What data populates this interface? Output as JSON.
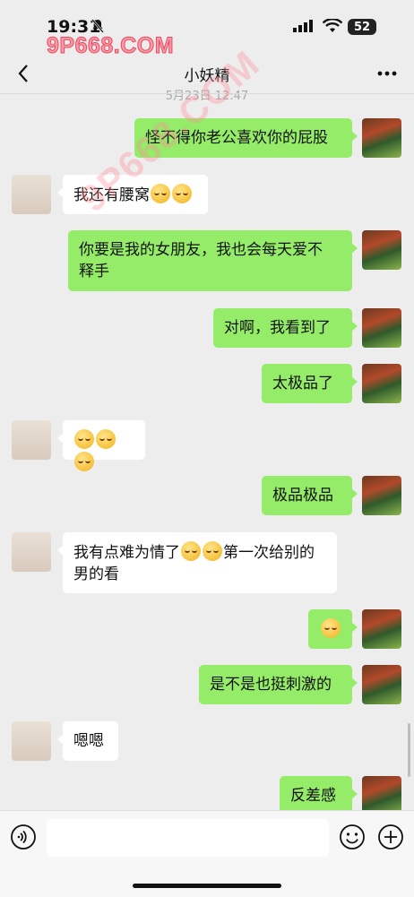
{
  "status_bar": {
    "time": "19:31",
    "battery": "52"
  },
  "watermark": {
    "top": "9P668.COM"
  },
  "header": {
    "title": "小妖精",
    "timestamp": "5月23日 12:47"
  },
  "messages": [
    {
      "from": "me",
      "text": "怪不得你老公喜欢你的屁股"
    },
    {
      "from": "them",
      "text": "我还有腰窝",
      "emojis": 2
    },
    {
      "from": "me",
      "text": "你要是我的女朋友，我也会每天爱不\n释手"
    },
    {
      "from": "me",
      "text": "对啊，我看到了"
    },
    {
      "from": "me",
      "text": "太极品了"
    },
    {
      "from": "them",
      "text": "",
      "emojis": 3
    },
    {
      "from": "me",
      "text": "极品极品"
    },
    {
      "from": "them",
      "text_before": "我有点难为情了",
      "emojis": 2,
      "text_after": "第一次给别的",
      "text_line2": "男的看"
    },
    {
      "from": "me",
      "text": "",
      "emojis": 1
    },
    {
      "from": "me",
      "text": "是不是也挺刺激的"
    },
    {
      "from": "them",
      "text": "嗯嗯"
    },
    {
      "from": "me",
      "text": "反差感"
    }
  ],
  "icons": {
    "back": "chevron-left-icon",
    "more": "more-dots-icon",
    "voice": "voice-icon",
    "emoji": "emoji-face-icon",
    "plus": "plus-icon"
  }
}
